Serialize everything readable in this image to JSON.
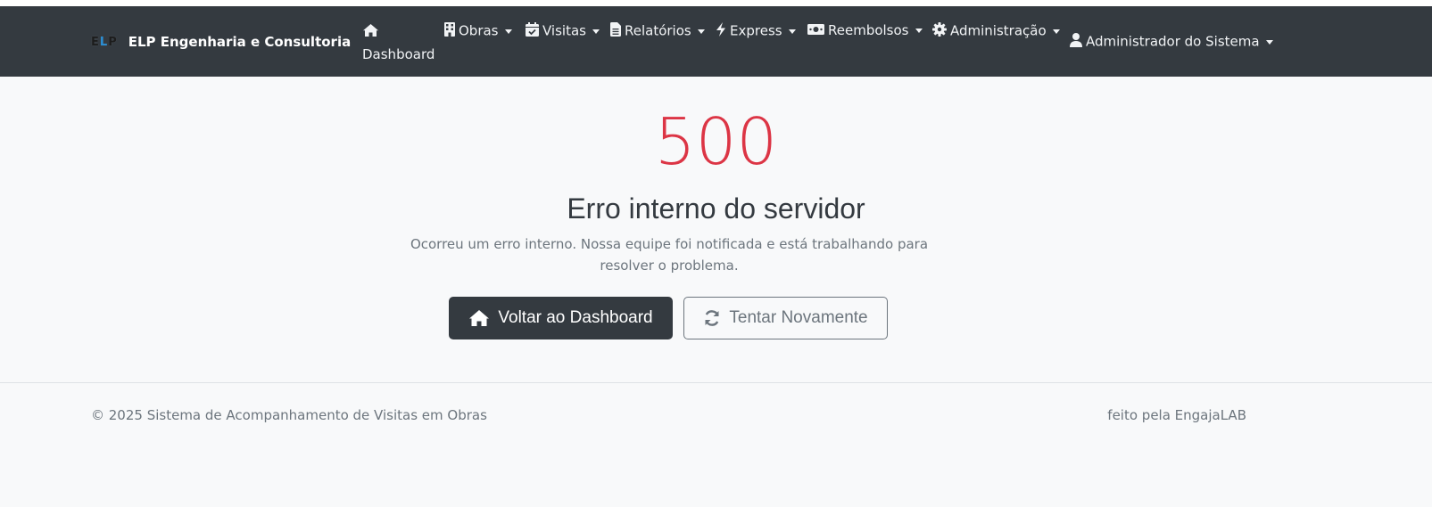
{
  "brand": {
    "logo_text": "ELP",
    "name": "ELP Engenharia e Consultoria"
  },
  "nav": {
    "dashboard": {
      "label": "Dashboard",
      "icon": "home-icon"
    },
    "obras": {
      "label": "Obras",
      "icon": "building-icon"
    },
    "visitas": {
      "label": "Visitas",
      "icon": "calendar-check-icon"
    },
    "relatorios": {
      "label": "Relatórios",
      "icon": "file-icon"
    },
    "express": {
      "label": "Express",
      "icon": "bolt-icon"
    },
    "reembolsos": {
      "label": "Reembolsos",
      "icon": "money-icon"
    },
    "administracao": {
      "label": "Administração",
      "icon": "gear-icon"
    },
    "user": {
      "label": "Administrador do Sistema",
      "icon": "user-icon"
    }
  },
  "error": {
    "code": "500",
    "title": "Erro interno do servidor",
    "description": "Ocorreu um erro interno. Nossa equipe foi notificada e está trabalhando para resolver o problema."
  },
  "actions": {
    "back_label": "Voltar ao Dashboard",
    "retry_label": "Tentar Novamente"
  },
  "footer": {
    "copyright": "© 2025 Sistema de Acompanhamento de Visitas em Obras",
    "credit": "feito pela EngajaLAB"
  },
  "colors": {
    "navbar": "#343a40",
    "error_code": "#dc3545",
    "muted": "#6c757d",
    "page_bg": "#f8f9fa"
  }
}
